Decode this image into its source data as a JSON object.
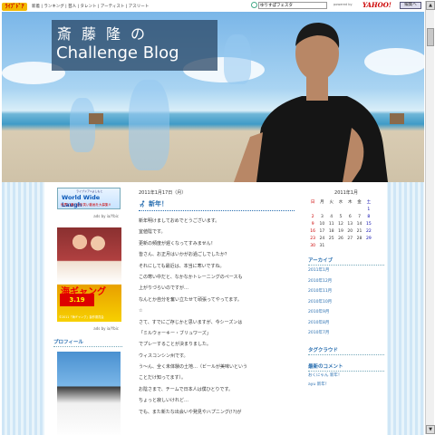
{
  "topbar": {
    "logo": "ﾗｲﾌﾞﾄﾞｱ",
    "nav": "新着 | ランキング | 芸人 | タレント | アーティスト | アスリート",
    "search_value": "ゆりすぽフェスタ",
    "powered_by": "powered by",
    "yahoo": "YAHOO!",
    "edit_button": "編集へ"
  },
  "header": {
    "title_jp": "斎藤隆の",
    "title_en": "Challenge Blog"
  },
  "left": {
    "ad1_brand": "ライブドア×よしもと",
    "ad1_title": "World Wide Laugh",
    "ad1_sub": "世界に通じるお笑い動画を大募集!!",
    "ads_by1": "ads by ia/Ybic",
    "ad2_title": "海ギャング",
    "ad2_date": "3.19",
    "ad2_copy": "©2011「海ギャング」製作委員会",
    "ads_by2": "ads by ia/Ybic",
    "profile_head": "プロフィール"
  },
  "post": {
    "date": "2011年1月17日（月）",
    "title": "新年！",
    "lines": [
      "新年明けましておめでとうございます。",
      "宜値陰です。",
      "更新の頻度が遅くなってすみません！",
      "皆さん、お正月はいかがお過ごしでしたか？",
      "それにしても最近は、本当に寒いですね。",
      "この寒い中だと、なかなかトレーニングのペースも",
      "上がりづらいのですが…",
      "なんとか自分を奮い立たせて頑張ってやってます。",
      "☆",
      "さて、すでにご存じかと思いますが、今シーズンは",
      "「ミルウォーキー・ブリュワーズ」",
      "でプレーすることが決まりました。",
      "ウィスコンシン州です。",
      "う〜ん、全く未体験の土地…（ビールが美味いという",
      "ことだけ知ってます）。",
      "お陰さまで、チームで日本人は僕ひとりです。",
      "ちょっと寂しいけれど…",
      "でも、また新たな出会いや発見やハプニング(!?)が"
    ]
  },
  "right": {
    "calendar_head": "2011年1月",
    "weekdays": [
      "日",
      "月",
      "火",
      "水",
      "木",
      "金",
      "土"
    ],
    "weeks": [
      [
        "",
        "",
        "",
        "",
        "",
        "",
        "1"
      ],
      [
        "2",
        "3",
        "4",
        "5",
        "6",
        "7",
        "8"
      ],
      [
        "9",
        "10",
        "11",
        "12",
        "13",
        "14",
        "15"
      ],
      [
        "16",
        "17",
        "18",
        "19",
        "20",
        "21",
        "22"
      ],
      [
        "23",
        "24",
        "25",
        "26",
        "27",
        "28",
        "29"
      ],
      [
        "30",
        "31",
        "",
        "",
        "",
        "",
        ""
      ]
    ],
    "archive_head": "アーカイブ",
    "archives": [
      "2011年1月",
      "2010年12月",
      "2010年11月",
      "2010年10月",
      "2010年9月",
      "2010年8月",
      "2010年7月"
    ],
    "tagcloud_head": "タグクラウド",
    "comments_head": "最新のコメント",
    "comments": [
      {
        "who": "おくにゃん",
        "label": "新年！"
      },
      {
        "who": "ayu",
        "label": "新年！"
      }
    ]
  }
}
